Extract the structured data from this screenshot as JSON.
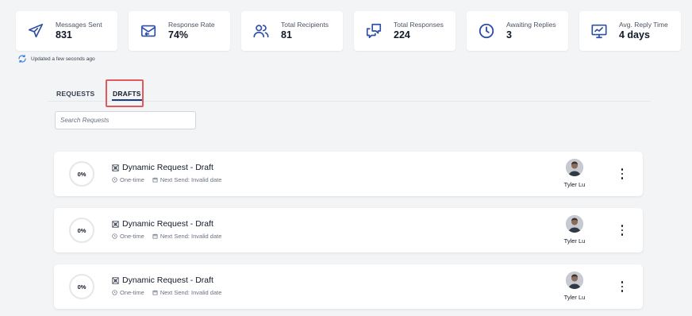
{
  "stats": [
    {
      "label": "Messages Sent",
      "value": "831",
      "icon": "send-icon"
    },
    {
      "label": "Response Rate",
      "value": "74%",
      "icon": "mail-reply-icon"
    },
    {
      "label": "Total Recipients",
      "value": "81",
      "icon": "users-icon"
    },
    {
      "label": "Total Responses",
      "value": "224",
      "icon": "chat-icon"
    },
    {
      "label": "Awaiting Replies",
      "value": "3",
      "icon": "clock-icon"
    },
    {
      "label": "Avg. Reply Time",
      "value": "4 days",
      "icon": "monitor-chart-icon"
    }
  ],
  "updated_text": "Updated a few seconds ago",
  "tabs": {
    "requests": "REQUESTS",
    "drafts": "DRAFTS",
    "active": "drafts"
  },
  "search": {
    "placeholder": "Search Requests",
    "value": ""
  },
  "requests": [
    {
      "progress": "0%",
      "title": "Dynamic Request - Draft",
      "frequency": "One-time",
      "next_send": "Next Send: Invalid date",
      "owner": "Tyler Lu"
    },
    {
      "progress": "0%",
      "title": "Dynamic Request - Draft",
      "frequency": "One-time",
      "next_send": "Next Send: Invalid date",
      "owner": "Tyler Lu"
    },
    {
      "progress": "0%",
      "title": "Dynamic Request - Draft",
      "frequency": "One-time",
      "next_send": "Next Send: Invalid date",
      "owner": "Tyler Lu"
    }
  ],
  "colors": {
    "accent": "#1e3a8a",
    "icon": "#2e4fa3",
    "highlight": "#e05a5a",
    "background": "#f3f4f6"
  }
}
